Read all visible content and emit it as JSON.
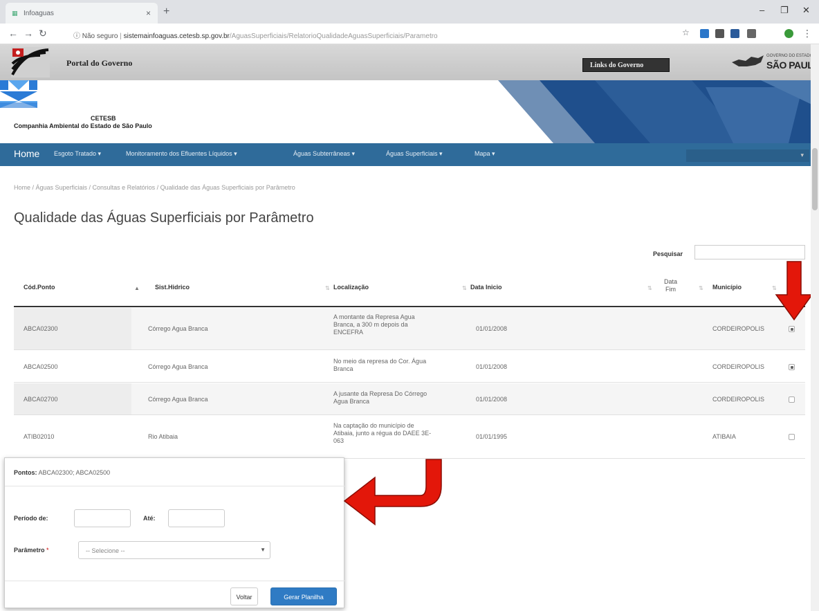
{
  "browser": {
    "tab_title": "Infoaguas",
    "tab_close": "×",
    "new_tab": "+",
    "security_label": "ⓘ Não seguro",
    "url_host": "sistemainfoaguas.cetesb.sp.gov.br",
    "url_path": "/AguasSuperficiais/RelatorioQualidadeAguasSuperficiais/Parametro"
  },
  "portal": {
    "title": "Portal do Governo",
    "links_button": "Links do Governo",
    "gov_line1": "GOVERNO DO ESTADO",
    "gov_line2": "SÃO PAULO"
  },
  "org": {
    "short_name": "CETESB",
    "full_name": "Companhia Ambiental do Estado de São Paulo"
  },
  "nav": {
    "home": "Home",
    "items": [
      "Esgoto Tratado ▾",
      "Monitoramento dos Efluentes Líquidos ▾",
      "Águas Subterrâneas ▾",
      "Águas Superficiais ▾",
      "Mapa ▾"
    ]
  },
  "breadcrumb": "Home  /  Águas Superficiais  /  Consultas e Relatórios  /  Qualidade das Águas Superficiais por Parâmetro",
  "page_title": "Qualidade das Águas Superficiais por Parâmetro",
  "search": {
    "label": "Pesquisar",
    "value": ""
  },
  "table": {
    "headers": {
      "cod": "Cód.Ponto",
      "sist": "Sist.Hidrico",
      "loc": "Localização",
      "ini": "Data Inicio",
      "fim_1": "Data",
      "fim_2": "Fim",
      "mun": "Município"
    },
    "rows": [
      {
        "cod": "ABCA02300",
        "sist": "Córrego Agua Branca",
        "loc_1": "A montante da Represa Agua",
        "loc_2": "Branca, a 300 m depois da",
        "loc_3": "ENCEFRA",
        "ini": "01/01/2008",
        "fim": "",
        "mun": "CORDEIROPOLIS",
        "checked": true
      },
      {
        "cod": "ABCA02500",
        "sist": "Córrego Agua Branca",
        "loc_1": "No meio da represa do Cor. Água",
        "loc_2": "Branca",
        "loc_3": "",
        "ini": "01/01/2008",
        "fim": "",
        "mun": "CORDEIROPOLIS",
        "checked": true
      },
      {
        "cod": "ABCA02700",
        "sist": "Córrego Agua Branca",
        "loc_1": "A jusante da Represa Do Córrego",
        "loc_2": "Agua Branca",
        "loc_3": "",
        "ini": "01/01/2008",
        "fim": "",
        "mun": "CORDEIROPOLIS",
        "checked": false
      },
      {
        "cod": "ATIB02010",
        "sist": "Rio Atibaia",
        "loc_1": "Na captação do município de",
        "loc_2": "Atibaia, junto a régua do DAEE 3E-",
        "loc_3": "063",
        "ini": "01/01/1995",
        "fim": "",
        "mun": "ATIBAIA",
        "checked": false
      }
    ]
  },
  "panel": {
    "points_label": "Pontos:",
    "points_value": "ABCA02300; ABCA02500",
    "period_from_label": "Período de:",
    "period_to_label": "Até:",
    "period_from_value": "",
    "period_to_value": "",
    "param_label": "Parâmetro",
    "param_required": "*",
    "param_placeholder": "-- Selecione --",
    "back_button": "Voltar",
    "generate_button": "Gerar Planilha"
  },
  "colors": {
    "nav": "#2f6b9a",
    "primary_button": "#2f7bc4",
    "arrow": "#e3170a"
  }
}
